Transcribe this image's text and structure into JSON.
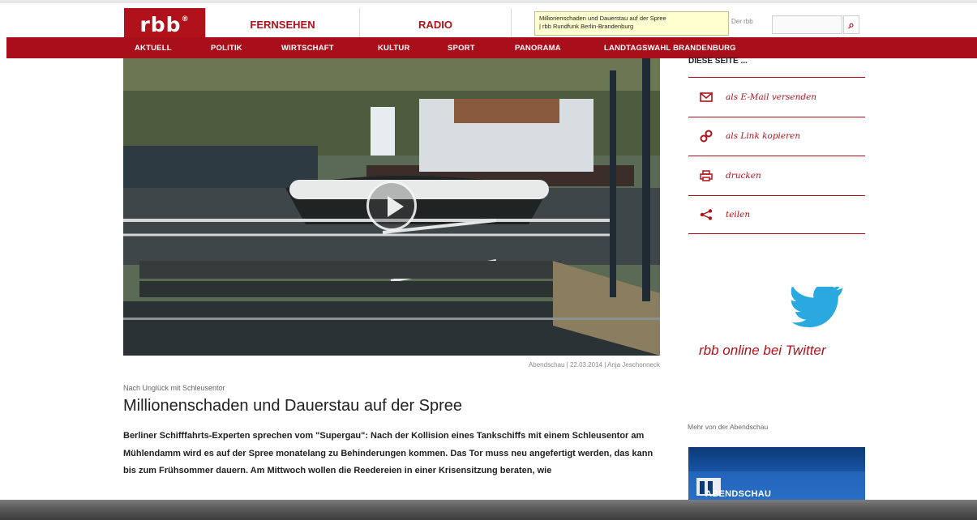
{
  "header": {
    "logo_text": "rbb",
    "logo_mark": "®",
    "nav": [
      "FERNSEHEN",
      "RADIO"
    ],
    "tooltip_line1": "Millionenschaden und Dauerstau auf der Spree",
    "tooltip_line2": "| rbb Rundfunk Berlin-Brandenburg",
    "der_rbb": "Der rbb",
    "search_value": "",
    "search_icon": "search-icon"
  },
  "categories": [
    "AKTUELL",
    "POLITIK",
    "WIRTSCHAFT",
    "KULTUR",
    "SPORT",
    "PANORAMA",
    "LANDTAGSWAHL BRANDENBURG"
  ],
  "active_category": "PANORAMA",
  "video": {
    "credit": "Abendschau | 22.03.2014 | Anja Jeschonneck",
    "play_icon": "play-icon"
  },
  "article": {
    "kicker": "Nach Unglück mit Schleusentor",
    "headline": "Millionenschaden und Dauerstau auf der Spree",
    "lead": "Berliner Schifffahrts-Experten sprechen vom \"Supergau\": Nach der Kollision eines Tankschiffs mit einem Schleusentor am Mühlendamm wird es auf der Spree monatelang zu Behinderungen kommen. Das Tor muss neu angefertigt werden, das kann bis zum Frühsommer dauern. Am Mittwoch wollen die Reedereien in einer Krisensitzung beraten, wie"
  },
  "sidebar": {
    "heading": "DIESE SEITE ...",
    "share": [
      {
        "label": "als E-Mail versenden",
        "icon": "mail-icon"
      },
      {
        "label": "als Link kopieren",
        "icon": "link-icon"
      },
      {
        "label": "drucken",
        "icon": "print-icon"
      },
      {
        "label": "teilen",
        "icon": "share-icon"
      }
    ],
    "twitter_text": "rbb online bei Twitter",
    "twitter_icon": "twitter-bird-icon",
    "mehr": "Mehr von der Abendschau",
    "abendschau_logo": "ABENDSCHAU"
  },
  "colors": {
    "brand_red": "#a90f1b",
    "twitter_blue": "#2aa9e0"
  }
}
